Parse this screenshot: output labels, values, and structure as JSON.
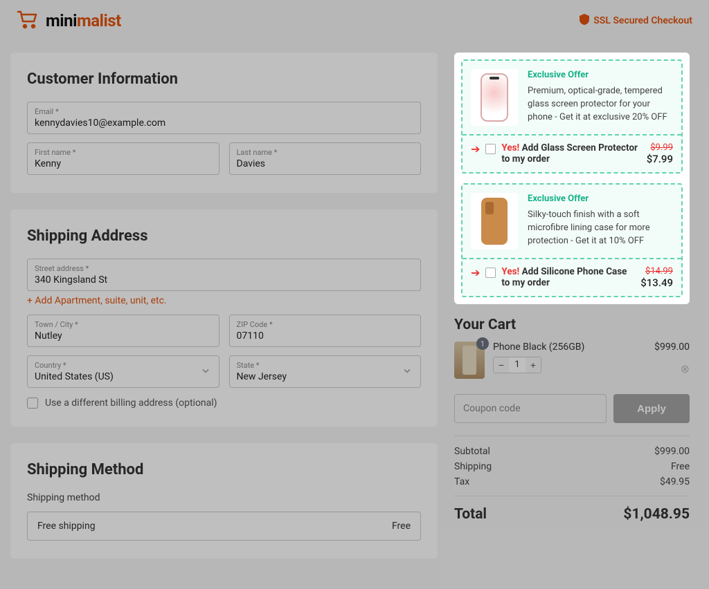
{
  "header": {
    "logo_mini": "mini",
    "logo_malist": "malist",
    "ssl": "SSL Secured Checkout"
  },
  "customer": {
    "heading": "Customer Information",
    "email_label": "Email *",
    "email": "kennydavies10@example.com",
    "first_label": "First name *",
    "first": "Kenny",
    "last_label": "Last name *",
    "last": "Davies"
  },
  "shipping": {
    "heading": "Shipping Address",
    "street_label": "Street address *",
    "street": "340 Kingsland St",
    "add_apt": "+ Add Apartment, suite, unit, etc.",
    "town_label": "Town / City *",
    "town": "Nutley",
    "zip_label": "ZIP Code *",
    "zip": "07110",
    "country_label": "Country *",
    "country": "United States (US)",
    "state_label": "State *",
    "state": "New Jersey",
    "diff_billing": "Use a different billing address (optional)"
  },
  "method": {
    "heading": "Shipping Method",
    "label": "Shipping method",
    "option": "Free shipping",
    "option_price": "Free"
  },
  "bumps": [
    {
      "title": "Exclusive Offer",
      "desc": "Premium, optical-grade, tempered glass screen protector for your phone - Get it at exclusive 20% OFF",
      "yes": "Yes!",
      "cta": " Add Glass Screen Protector to my order",
      "old": "$9.99",
      "new": "$7.99"
    },
    {
      "title": "Exclusive Offer",
      "desc": "Silky-touch finish with a soft microfibre lining case for more protection - Get it at 10% OFF",
      "yes": "Yes!",
      "cta": " Add Silicone Phone Case to my order",
      "old": "$14.99",
      "new": "$13.49"
    }
  ],
  "cart": {
    "heading": "Your Cart",
    "item_name": "Phone Black (256GB)",
    "item_price": "$999.00",
    "qty": "1",
    "badge": "1",
    "coupon_placeholder": "Coupon code",
    "apply": "Apply",
    "subtotal_l": "Subtotal",
    "subtotal_v": "$999.00",
    "ship_l": "Shipping",
    "ship_v": "Free",
    "tax_l": "Tax",
    "tax_v": "$49.95",
    "total_l": "Total",
    "total_v": "$1,048.95"
  }
}
